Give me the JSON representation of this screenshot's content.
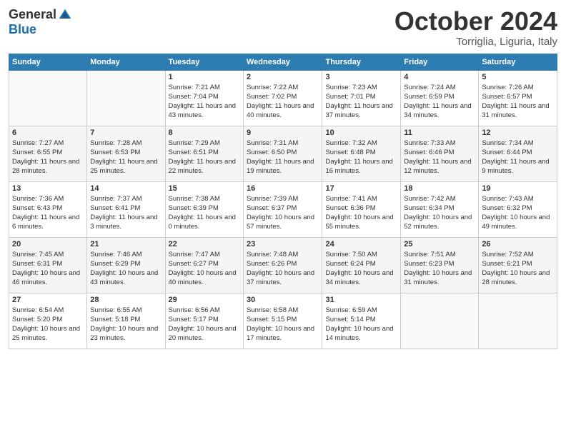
{
  "header": {
    "logo_general": "General",
    "logo_blue": "Blue",
    "month_title": "October 2024",
    "subtitle": "Torriglia, Liguria, Italy"
  },
  "days_of_week": [
    "Sunday",
    "Monday",
    "Tuesday",
    "Wednesday",
    "Thursday",
    "Friday",
    "Saturday"
  ],
  "weeks": [
    [
      {
        "day": "",
        "sunrise": "",
        "sunset": "",
        "daylight": ""
      },
      {
        "day": "",
        "sunrise": "",
        "sunset": "",
        "daylight": ""
      },
      {
        "day": "1",
        "sunrise": "Sunrise: 7:21 AM",
        "sunset": "Sunset: 7:04 PM",
        "daylight": "Daylight: 11 hours and 43 minutes."
      },
      {
        "day": "2",
        "sunrise": "Sunrise: 7:22 AM",
        "sunset": "Sunset: 7:02 PM",
        "daylight": "Daylight: 11 hours and 40 minutes."
      },
      {
        "day": "3",
        "sunrise": "Sunrise: 7:23 AM",
        "sunset": "Sunset: 7:01 PM",
        "daylight": "Daylight: 11 hours and 37 minutes."
      },
      {
        "day": "4",
        "sunrise": "Sunrise: 7:24 AM",
        "sunset": "Sunset: 6:59 PM",
        "daylight": "Daylight: 11 hours and 34 minutes."
      },
      {
        "day": "5",
        "sunrise": "Sunrise: 7:26 AM",
        "sunset": "Sunset: 6:57 PM",
        "daylight": "Daylight: 11 hours and 31 minutes."
      }
    ],
    [
      {
        "day": "6",
        "sunrise": "Sunrise: 7:27 AM",
        "sunset": "Sunset: 6:55 PM",
        "daylight": "Daylight: 11 hours and 28 minutes."
      },
      {
        "day": "7",
        "sunrise": "Sunrise: 7:28 AM",
        "sunset": "Sunset: 6:53 PM",
        "daylight": "Daylight: 11 hours and 25 minutes."
      },
      {
        "day": "8",
        "sunrise": "Sunrise: 7:29 AM",
        "sunset": "Sunset: 6:51 PM",
        "daylight": "Daylight: 11 hours and 22 minutes."
      },
      {
        "day": "9",
        "sunrise": "Sunrise: 7:31 AM",
        "sunset": "Sunset: 6:50 PM",
        "daylight": "Daylight: 11 hours and 19 minutes."
      },
      {
        "day": "10",
        "sunrise": "Sunrise: 7:32 AM",
        "sunset": "Sunset: 6:48 PM",
        "daylight": "Daylight: 11 hours and 16 minutes."
      },
      {
        "day": "11",
        "sunrise": "Sunrise: 7:33 AM",
        "sunset": "Sunset: 6:46 PM",
        "daylight": "Daylight: 11 hours and 12 minutes."
      },
      {
        "day": "12",
        "sunrise": "Sunrise: 7:34 AM",
        "sunset": "Sunset: 6:44 PM",
        "daylight": "Daylight: 11 hours and 9 minutes."
      }
    ],
    [
      {
        "day": "13",
        "sunrise": "Sunrise: 7:36 AM",
        "sunset": "Sunset: 6:43 PM",
        "daylight": "Daylight: 11 hours and 6 minutes."
      },
      {
        "day": "14",
        "sunrise": "Sunrise: 7:37 AM",
        "sunset": "Sunset: 6:41 PM",
        "daylight": "Daylight: 11 hours and 3 minutes."
      },
      {
        "day": "15",
        "sunrise": "Sunrise: 7:38 AM",
        "sunset": "Sunset: 6:39 PM",
        "daylight": "Daylight: 11 hours and 0 minutes."
      },
      {
        "day": "16",
        "sunrise": "Sunrise: 7:39 AM",
        "sunset": "Sunset: 6:37 PM",
        "daylight": "Daylight: 10 hours and 57 minutes."
      },
      {
        "day": "17",
        "sunrise": "Sunrise: 7:41 AM",
        "sunset": "Sunset: 6:36 PM",
        "daylight": "Daylight: 10 hours and 55 minutes."
      },
      {
        "day": "18",
        "sunrise": "Sunrise: 7:42 AM",
        "sunset": "Sunset: 6:34 PM",
        "daylight": "Daylight: 10 hours and 52 minutes."
      },
      {
        "day": "19",
        "sunrise": "Sunrise: 7:43 AM",
        "sunset": "Sunset: 6:32 PM",
        "daylight": "Daylight: 10 hours and 49 minutes."
      }
    ],
    [
      {
        "day": "20",
        "sunrise": "Sunrise: 7:45 AM",
        "sunset": "Sunset: 6:31 PM",
        "daylight": "Daylight: 10 hours and 46 minutes."
      },
      {
        "day": "21",
        "sunrise": "Sunrise: 7:46 AM",
        "sunset": "Sunset: 6:29 PM",
        "daylight": "Daylight: 10 hours and 43 minutes."
      },
      {
        "day": "22",
        "sunrise": "Sunrise: 7:47 AM",
        "sunset": "Sunset: 6:27 PM",
        "daylight": "Daylight: 10 hours and 40 minutes."
      },
      {
        "day": "23",
        "sunrise": "Sunrise: 7:48 AM",
        "sunset": "Sunset: 6:26 PM",
        "daylight": "Daylight: 10 hours and 37 minutes."
      },
      {
        "day": "24",
        "sunrise": "Sunrise: 7:50 AM",
        "sunset": "Sunset: 6:24 PM",
        "daylight": "Daylight: 10 hours and 34 minutes."
      },
      {
        "day": "25",
        "sunrise": "Sunrise: 7:51 AM",
        "sunset": "Sunset: 6:23 PM",
        "daylight": "Daylight: 10 hours and 31 minutes."
      },
      {
        "day": "26",
        "sunrise": "Sunrise: 7:52 AM",
        "sunset": "Sunset: 6:21 PM",
        "daylight": "Daylight: 10 hours and 28 minutes."
      }
    ],
    [
      {
        "day": "27",
        "sunrise": "Sunrise: 6:54 AM",
        "sunset": "Sunset: 5:20 PM",
        "daylight": "Daylight: 10 hours and 25 minutes."
      },
      {
        "day": "28",
        "sunrise": "Sunrise: 6:55 AM",
        "sunset": "Sunset: 5:18 PM",
        "daylight": "Daylight: 10 hours and 23 minutes."
      },
      {
        "day": "29",
        "sunrise": "Sunrise: 6:56 AM",
        "sunset": "Sunset: 5:17 PM",
        "daylight": "Daylight: 10 hours and 20 minutes."
      },
      {
        "day": "30",
        "sunrise": "Sunrise: 6:58 AM",
        "sunset": "Sunset: 5:15 PM",
        "daylight": "Daylight: 10 hours and 17 minutes."
      },
      {
        "day": "31",
        "sunrise": "Sunrise: 6:59 AM",
        "sunset": "Sunset: 5:14 PM",
        "daylight": "Daylight: 10 hours and 14 minutes."
      },
      {
        "day": "",
        "sunrise": "",
        "sunset": "",
        "daylight": ""
      },
      {
        "day": "",
        "sunrise": "",
        "sunset": "",
        "daylight": ""
      }
    ]
  ]
}
